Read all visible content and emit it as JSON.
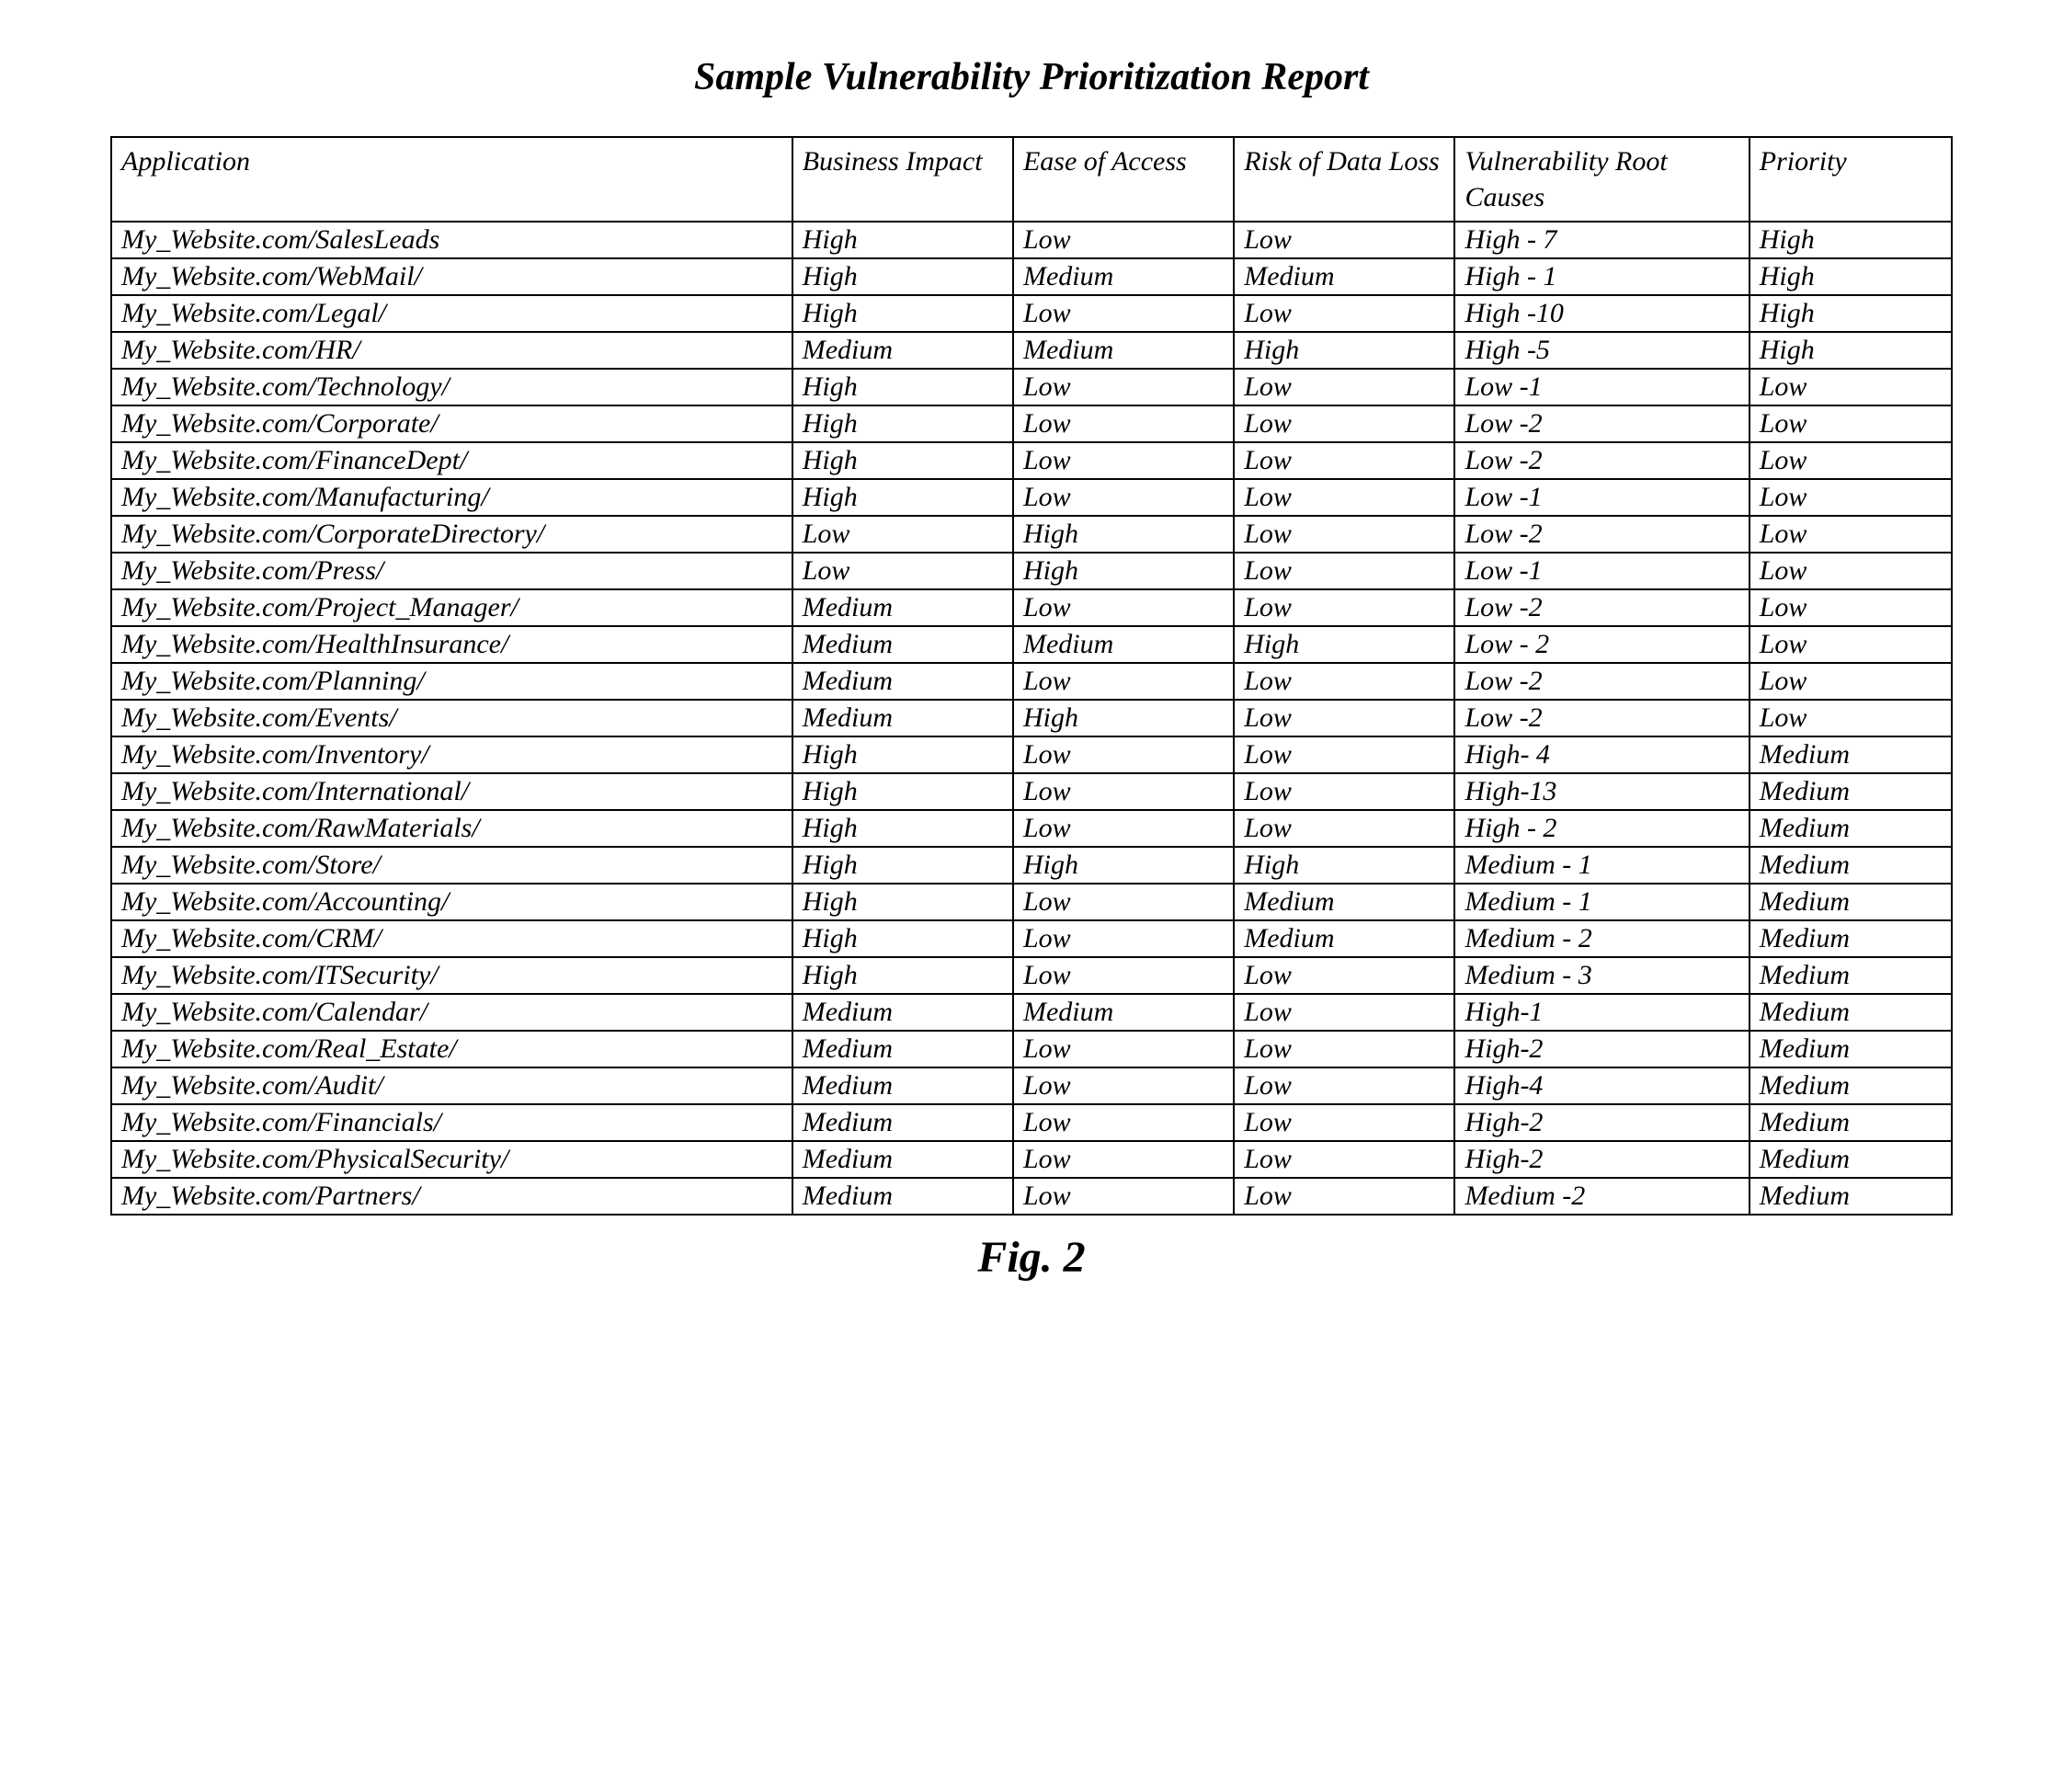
{
  "title": "Sample Vulnerability Prioritization Report",
  "figure_label": "Fig. 2",
  "columns": {
    "application": "Application",
    "business_impact": "Business Impact",
    "ease_of_access": "Ease of Access",
    "risk_of_data_loss": "Risk of Data Loss",
    "root_causes": "Vulnerability Root Causes",
    "priority": "Priority"
  },
  "rows": [
    {
      "application": "My_Website.com/SalesLeads",
      "business_impact": "High",
      "ease_of_access": "Low",
      "risk_of_data_loss": "Low",
      "root_causes": "High - 7",
      "priority": "High"
    },
    {
      "application": "My_Website.com/WebMail/",
      "business_impact": "High",
      "ease_of_access": "Medium",
      "risk_of_data_loss": "Medium",
      "root_causes": "High - 1",
      "priority": "High"
    },
    {
      "application": "My_Website.com/Legal/",
      "business_impact": "High",
      "ease_of_access": "Low",
      "risk_of_data_loss": "Low",
      "root_causes": "High -10",
      "priority": "High"
    },
    {
      "application": "My_Website.com/HR/",
      "business_impact": "Medium",
      "ease_of_access": "Medium",
      "risk_of_data_loss": "High",
      "root_causes": "High -5",
      "priority": "High"
    },
    {
      "application": "My_Website.com/Technology/",
      "business_impact": "High",
      "ease_of_access": "Low",
      "risk_of_data_loss": "Low",
      "root_causes": "Low -1",
      "priority": "Low"
    },
    {
      "application": "My_Website.com/Corporate/",
      "business_impact": "High",
      "ease_of_access": "Low",
      "risk_of_data_loss": "Low",
      "root_causes": "Low -2",
      "priority": "Low"
    },
    {
      "application": "My_Website.com/FinanceDept/",
      "business_impact": "High",
      "ease_of_access": "Low",
      "risk_of_data_loss": "Low",
      "root_causes": "Low -2",
      "priority": "Low"
    },
    {
      "application": "My_Website.com/Manufacturing/",
      "business_impact": "High",
      "ease_of_access": "Low",
      "risk_of_data_loss": "Low",
      "root_causes": "Low -1",
      "priority": "Low"
    },
    {
      "application": "My_Website.com/CorporateDirectory/",
      "business_impact": "Low",
      "ease_of_access": "High",
      "risk_of_data_loss": "Low",
      "root_causes": "Low -2",
      "priority": "Low"
    },
    {
      "application": "My_Website.com/Press/",
      "business_impact": "Low",
      "ease_of_access": "High",
      "risk_of_data_loss": "Low",
      "root_causes": "Low -1",
      "priority": "Low"
    },
    {
      "application": "My_Website.com/Project_Manager/",
      "business_impact": "Medium",
      "ease_of_access": "Low",
      "risk_of_data_loss": "Low",
      "root_causes": "Low -2",
      "priority": "Low"
    },
    {
      "application": "My_Website.com/HealthInsurance/",
      "business_impact": "Medium",
      "ease_of_access": "Medium",
      "risk_of_data_loss": "High",
      "root_causes": "Low - 2",
      "priority": "Low"
    },
    {
      "application": "My_Website.com/Planning/",
      "business_impact": "Medium",
      "ease_of_access": "Low",
      "risk_of_data_loss": "Low",
      "root_causes": "Low -2",
      "priority": "Low"
    },
    {
      "application": "My_Website.com/Events/",
      "business_impact": "Medium",
      "ease_of_access": "High",
      "risk_of_data_loss": "Low",
      "root_causes": "Low -2",
      "priority": "Low"
    },
    {
      "application": "My_Website.com/Inventory/",
      "business_impact": "High",
      "ease_of_access": "Low",
      "risk_of_data_loss": "Low",
      "root_causes": "High- 4",
      "priority": "Medium"
    },
    {
      "application": "My_Website.com/International/",
      "business_impact": "High",
      "ease_of_access": "Low",
      "risk_of_data_loss": "Low",
      "root_causes": "High-13",
      "priority": "Medium"
    },
    {
      "application": "My_Website.com/RawMaterials/",
      "business_impact": "High",
      "ease_of_access": "Low",
      "risk_of_data_loss": "Low",
      "root_causes": "High - 2",
      "priority": "Medium"
    },
    {
      "application": "My_Website.com/Store/",
      "business_impact": "High",
      "ease_of_access": "High",
      "risk_of_data_loss": "High",
      "root_causes": "Medium - 1",
      "priority": "Medium"
    },
    {
      "application": "My_Website.com/Accounting/",
      "business_impact": "High",
      "ease_of_access": "Low",
      "risk_of_data_loss": "Medium",
      "root_causes": "Medium - 1",
      "priority": "Medium"
    },
    {
      "application": "My_Website.com/CRM/",
      "business_impact": "High",
      "ease_of_access": "Low",
      "risk_of_data_loss": "Medium",
      "root_causes": "Medium - 2",
      "priority": "Medium"
    },
    {
      "application": "My_Website.com/ITSecurity/",
      "business_impact": "High",
      "ease_of_access": "Low",
      "risk_of_data_loss": "Low",
      "root_causes": "Medium - 3",
      "priority": "Medium"
    },
    {
      "application": "My_Website.com/Calendar/",
      "business_impact": "Medium",
      "ease_of_access": "Medium",
      "risk_of_data_loss": "Low",
      "root_causes": "High-1",
      "priority": "Medium"
    },
    {
      "application": "My_Website.com/Real_Estate/",
      "business_impact": "Medium",
      "ease_of_access": "Low",
      "risk_of_data_loss": "Low",
      "root_causes": "High-2",
      "priority": "Medium"
    },
    {
      "application": "My_Website.com/Audit/",
      "business_impact": "Medium",
      "ease_of_access": "Low",
      "risk_of_data_loss": "Low",
      "root_causes": "High-4",
      "priority": "Medium"
    },
    {
      "application": "My_Website.com/Financials/",
      "business_impact": "Medium",
      "ease_of_access": "Low",
      "risk_of_data_loss": "Low",
      "root_causes": "High-2",
      "priority": "Medium"
    },
    {
      "application": "My_Website.com/PhysicalSecurity/",
      "business_impact": "Medium",
      "ease_of_access": "Low",
      "risk_of_data_loss": "Low",
      "root_causes": "High-2",
      "priority": "Medium"
    },
    {
      "application": "My_Website.com/Partners/",
      "business_impact": "Medium",
      "ease_of_access": "Low",
      "risk_of_data_loss": "Low",
      "root_causes": "Medium -2",
      "priority": "Medium"
    }
  ]
}
